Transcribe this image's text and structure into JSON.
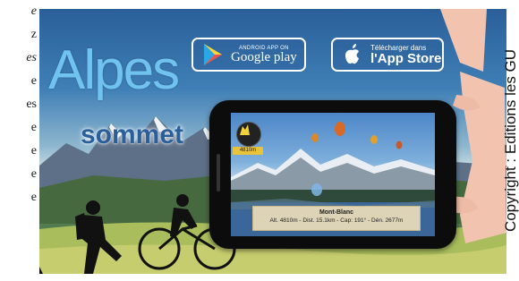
{
  "left_column": {
    "lines": [
      {
        "text": "e",
        "italic": true
      },
      {
        "text": "z",
        "italic": false
      },
      {
        "text": "es",
        "italic": true
      },
      {
        "text": "e",
        "italic": false
      },
      {
        "text": "es",
        "italic": false
      },
      {
        "text": "e",
        "italic": false
      },
      {
        "text": "e",
        "italic": false
      },
      {
        "text": "e",
        "italic": false
      },
      {
        "text": "e",
        "italic": false
      }
    ]
  },
  "banner": {
    "title": "Alpes",
    "subtitle": "sommet",
    "google_play": {
      "small": "ANDROID APP ON",
      "big": "Google play",
      "icon": "google-play-icon"
    },
    "app_store": {
      "small": "Télécharger dans",
      "big": "l'App Store",
      "icon": "apple-icon"
    }
  },
  "phone": {
    "badge_value": "4810m",
    "info": {
      "name": "Mont-Blanc",
      "details": "Alt. 4810m - Dist. 15.1km - Cap: 191° - Dén. 2677m"
    }
  },
  "copyright": "Copyright : Editions les GU",
  "colors": {
    "title": "#6fc3ee",
    "subtitle": "#2a5f9a",
    "sky": "#3f7fb6",
    "badge": "#e8c23a"
  }
}
